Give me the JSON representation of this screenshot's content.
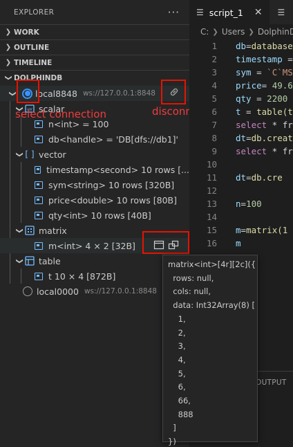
{
  "explorer": {
    "title": "EXPLORER",
    "more": "···",
    "sections": {
      "work": "WORK",
      "outline": "OUTLINE",
      "timeline": "TIMELINE",
      "dolphindb": "DOLPHINDB"
    }
  },
  "connections": [
    {
      "name": "local8848",
      "url": "ws://127.0.0.1:8848",
      "selected": true
    },
    {
      "name": "local0000",
      "url": "ws://127.0.0.1:8848",
      "selected": false
    }
  ],
  "tree": {
    "scalar": {
      "label": "scalar",
      "items": [
        "n<int> = 100",
        "db<handle> = 'DB[dfs://db1]'"
      ]
    },
    "vector": {
      "label": "vector",
      "items": [
        "timestamp<second> 10 rows [...",
        "sym<string> 10 rows [320B]",
        "price<double> 10 rows [80B]",
        "qty<int> 10 rows [40B]"
      ]
    },
    "matrix": {
      "label": "matrix",
      "items": [
        "m<int> 4 × 2 [32B]"
      ]
    },
    "table": {
      "label": "table",
      "items": [
        "t 10 × 4 [872B]"
      ]
    }
  },
  "annotations": {
    "select_connection": "select connection",
    "disconnect": "disconnect"
  },
  "tooltip": {
    "lines": [
      "matrix<int>[4r][2c]({",
      "  rows: null,",
      "  cols: null,",
      "  data: Int32Array(8) [",
      "    1,",
      "    2,",
      "    3,",
      "    4,",
      "    5,",
      "    6,",
      "    66,",
      "    888",
      "  ]",
      "})"
    ]
  },
  "editor": {
    "tab_label": "script_1",
    "tab_close": "✕",
    "breadcrumb": [
      "C:",
      "Users",
      "DolphinDB"
    ],
    "lines": [
      {
        "n": "1",
        "text": "db=database"
      },
      {
        "n": "2",
        "text": "timestamp ="
      },
      {
        "n": "3",
        "text": "sym = `C`MS"
      },
      {
        "n": "4",
        "text": "price= 49.6"
      },
      {
        "n": "5",
        "text": "qty = 2200"
      },
      {
        "n": "6",
        "text": "t = table(t"
      },
      {
        "n": "7",
        "text": "select * fr"
      },
      {
        "n": "8",
        "text": "dt=db.creat"
      },
      {
        "n": "9",
        "text": "select * fr"
      },
      {
        "n": "10",
        "text": ""
      },
      {
        "n": "11",
        "text": "dt=db.cre"
      },
      {
        "n": "12",
        "text": ""
      },
      {
        "n": "13",
        "text": "n=100"
      },
      {
        "n": "14",
        "text": ""
      },
      {
        "n": "15",
        "text": "m=matrix(1"
      },
      {
        "n": "16",
        "text": "m"
      }
    ],
    "panel_tab": "OUTPUT"
  },
  "colors": {
    "accent": "#3794ff",
    "annotation_red": "#e51400"
  }
}
